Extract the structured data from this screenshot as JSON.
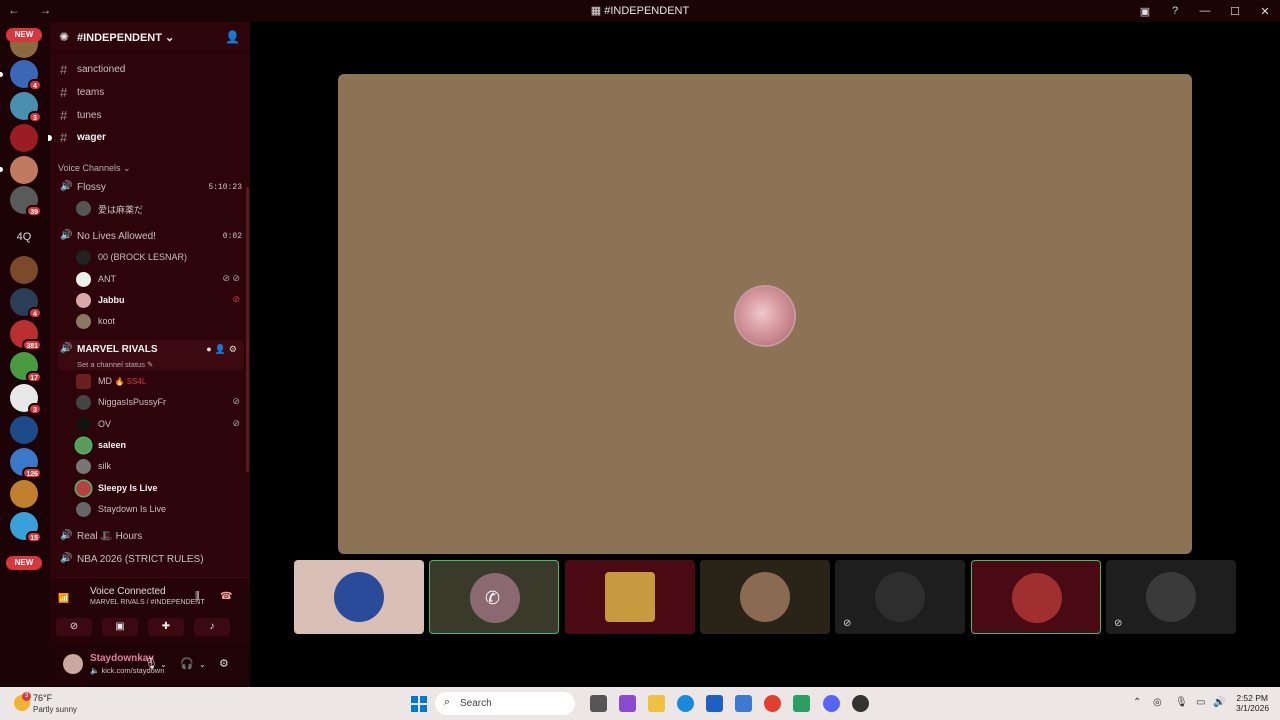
{
  "window": {
    "title": "#INDEPENDENT",
    "back_label": "←",
    "forward_label": "→",
    "controls": [
      "▣",
      "?",
      "—",
      "☐",
      "✕"
    ]
  },
  "server_rail": {
    "new_label": "NEW",
    "text_server": "4Q",
    "badges": [
      "4",
      "3",
      "39",
      "4",
      "381",
      "17",
      "3",
      "126",
      "15"
    ],
    "bottom_new_label": "NEW"
  },
  "guild": {
    "name": "#INDEPENDENT",
    "chevron": "⌄",
    "text_channels": [
      {
        "name": "sanctioned",
        "unread": false
      },
      {
        "name": "teams",
        "unread": false
      },
      {
        "name": "tunes",
        "unread": false
      },
      {
        "name": "wager",
        "unread": true
      }
    ],
    "voice_category": "Voice Channels",
    "voice_channels": [
      {
        "name": "Flossy",
        "time": "5:10:23",
        "users": [
          {
            "name": "愛は麻薬だ",
            "icons": ""
          }
        ]
      },
      {
        "name": "No Lives Allowed!",
        "time": "0:02",
        "users": [
          {
            "name": "00 (BROCK LESNAR)",
            "icons": ""
          },
          {
            "name": "ANT",
            "icons": "⊘ ⊘"
          },
          {
            "name": "Jabbu",
            "icons": "⊘"
          },
          {
            "name": "koot",
            "icons": ""
          }
        ]
      },
      {
        "name": "MARVEL RIVALS",
        "status": "Set a channel status",
        "users": [
          {
            "name": "MD",
            "tag": "🔥 SS4L",
            "icons": ""
          },
          {
            "name": "NiggasIsPussyFr",
            "icons": "⊘"
          },
          {
            "name": "OV",
            "icons": "⊘"
          },
          {
            "name": "saleen",
            "icons": ""
          },
          {
            "name": "silk",
            "icons": ""
          },
          {
            "name": "Sleepy Is Live",
            "icons": ""
          },
          {
            "name": "Staydown Is Live",
            "icons": ""
          }
        ]
      },
      {
        "name": "Real 🎩 Hours"
      },
      {
        "name": "NBA 2026 (STRICT RULES)"
      }
    ]
  },
  "voice_panel": {
    "title": "Voice Connected",
    "subtitle": "MARVEL RIVALS / #INDEPENDENT"
  },
  "user_panel": {
    "name": "Staydownkay",
    "status": "kick.com/staydown"
  },
  "taskbar": {
    "weather_badge": "3",
    "temperature": "76°F",
    "weather": "Partly sunny",
    "search_placeholder": "Search",
    "time": "2:52 PM",
    "date": "3/1/2026"
  },
  "colors": {
    "accent_red": "#da373c",
    "voice_green": "#4bb868",
    "sidebar_bg": "#2c0409",
    "stage_bg": "#8d7356"
  }
}
